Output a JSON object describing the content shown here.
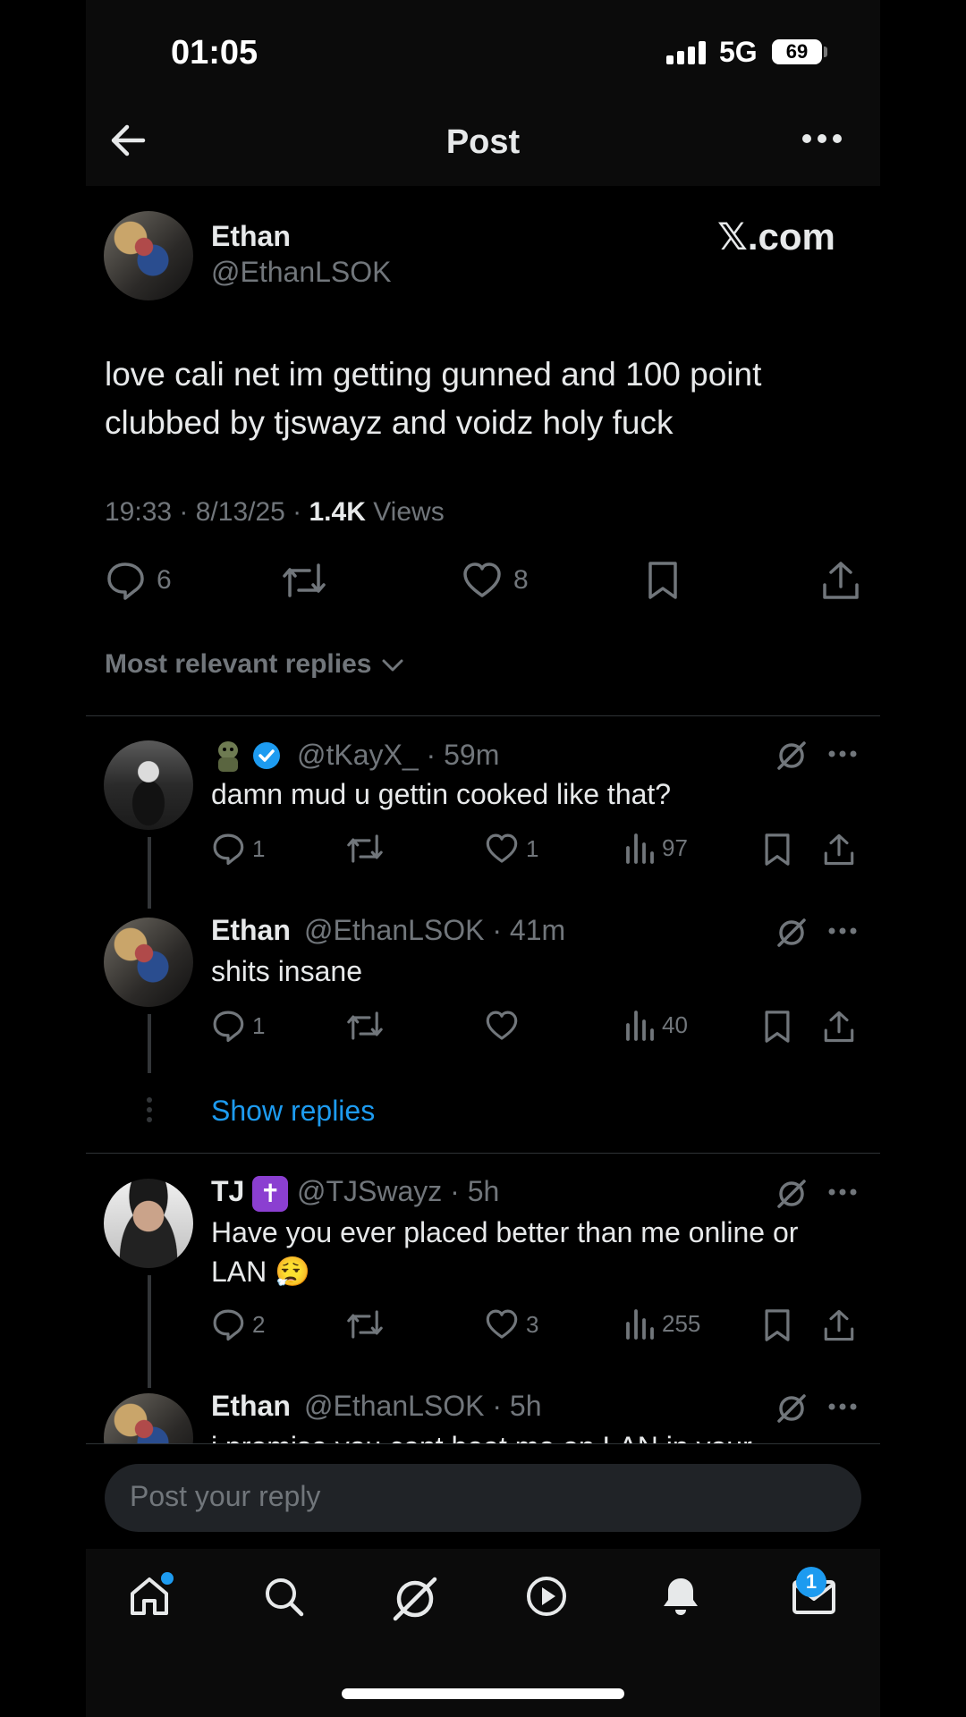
{
  "status_bar": {
    "time": "01:05",
    "network": "5G",
    "battery": "69"
  },
  "nav": {
    "title": "Post"
  },
  "post": {
    "author_name": "Ethan",
    "author_handle": "@EthanLSOK",
    "source_label": "𝕏.com",
    "text": "love cali net im getting gunned and 100 point clubbed by tjswayz and voidz holy fuck",
    "time": "19:33 · 8/13/25 · ",
    "views_count": "1.4K",
    "views_label": " Views",
    "replies": "6",
    "likes": "8"
  },
  "sort": {
    "label": "Most relevant replies"
  },
  "replies": [
    {
      "handle_time": "@tKayX_ · 59m",
      "text": "damn mud u gettin cooked like that?",
      "replies": "1",
      "likes": "1",
      "views": "97"
    },
    {
      "name": "Ethan",
      "handle_time": "@EthanLSOK · 41m",
      "text": "shits insane",
      "replies": "1",
      "likes": "",
      "views": "40"
    },
    {
      "name": "TJ",
      "badge": "✝",
      "handle_time": "@TJSwayz · 5h",
      "text": "Have you ever placed better than me online or LAN 😮‍💨",
      "replies": "2",
      "likes": "3",
      "views": "255"
    },
    {
      "name": "Ethan",
      "handle_time": "@EthanLSOK · 5h",
      "text": "i promise you cant beat me on LAN in your"
    }
  ],
  "show_replies": "Show replies",
  "composer": {
    "placeholder": "Post your reply"
  },
  "tabbar": {
    "messages_badge": "1"
  }
}
